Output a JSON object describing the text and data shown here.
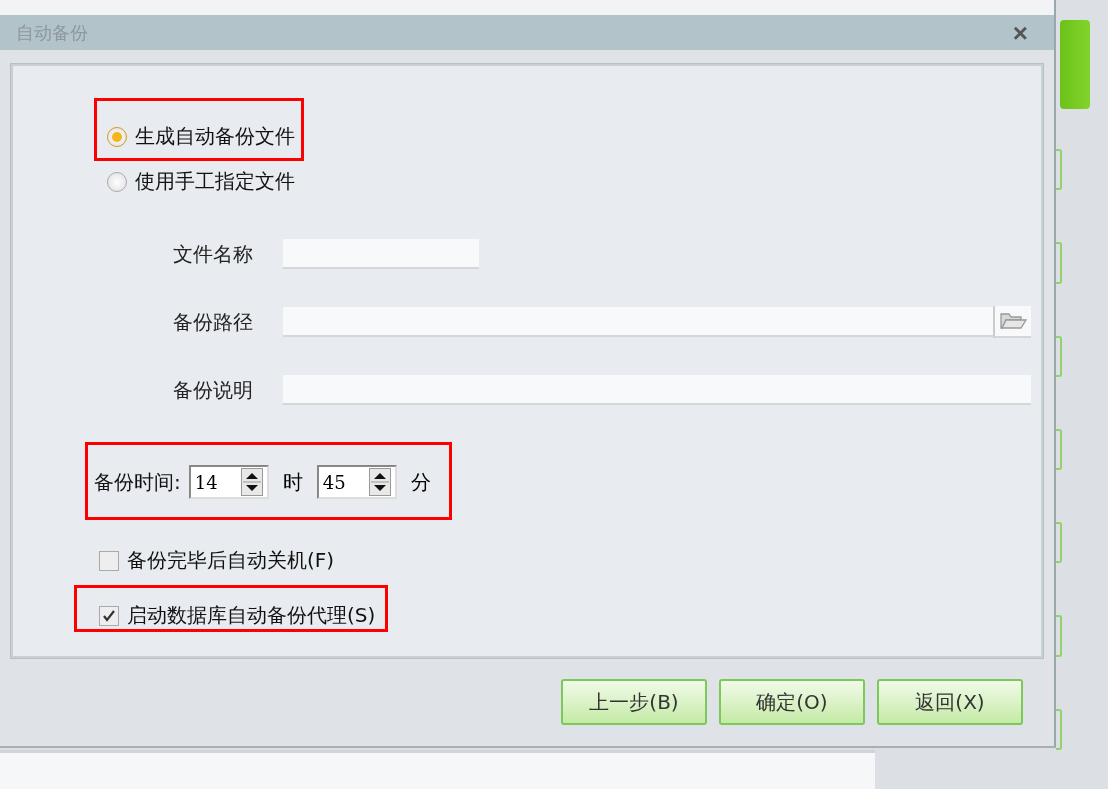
{
  "window": {
    "title": "自动备份",
    "close": "×"
  },
  "radios": [
    {
      "label": "生成自动备份文件",
      "selected": true,
      "highlighted": true
    },
    {
      "label": "使用手工指定文件",
      "selected": false,
      "highlighted": false
    }
  ],
  "fields": [
    {
      "kind": "short",
      "label": "文件名称"
    },
    {
      "kind": "browse",
      "label": "备份路径"
    },
    {
      "kind": "wide",
      "label": "备份说明"
    }
  ],
  "backup_time": {
    "label": "备份时间:",
    "highlighted": true,
    "hour": "14",
    "hour_unit": "时",
    "minute": "45",
    "minute_unit": "分"
  },
  "checkboxes": [
    {
      "label": "备份完毕后自动关机(F)",
      "checked": false,
      "highlighted": false
    },
    {
      "label": "启动数据库自动备份代理(S)",
      "checked": true,
      "highlighted": true
    }
  ],
  "buttons": [
    "上一步(B)",
    "确定(O)",
    "返回(X)"
  ]
}
